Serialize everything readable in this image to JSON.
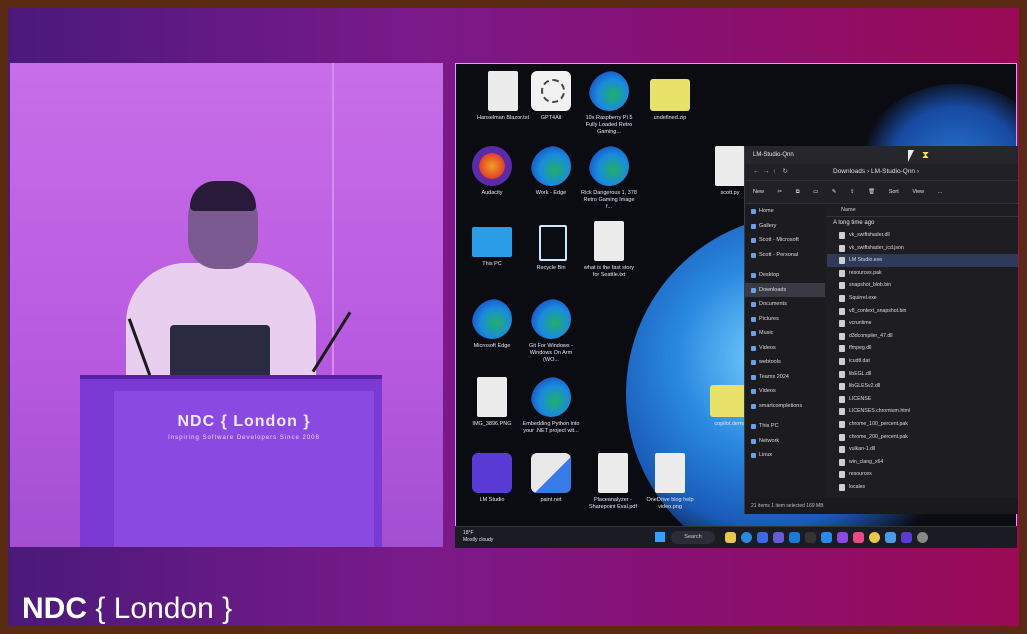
{
  "stage": {
    "podium_brand": "NDC { London }",
    "podium_tagline": "Inspiring Software Developers Since 2008",
    "footer_logo_bold": "NDC",
    "footer_logo_rest": "{ London }"
  },
  "desktop_icons": [
    {
      "label": "Hanselman Blazor.txt",
      "kind": "file"
    },
    {
      "label": "GPT4All",
      "kind": "pix"
    },
    {
      "label": "10x Raspberry Pi 5 Fully Loaded Retro Gaming...",
      "kind": "edge"
    },
    {
      "label": "undefined.zip",
      "kind": "folder"
    },
    {
      "label": "Audacity",
      "kind": "audacity"
    },
    {
      "label": "Work - Edge",
      "kind": "edge"
    },
    {
      "label": "Rick Dangerous 1, 378 Retro Gaming Image f...",
      "kind": "edge"
    },
    {
      "label": "This PC",
      "kind": "pc"
    },
    {
      "label": "Recycle Bin",
      "kind": "bin"
    },
    {
      "label": "what is the fast story for Seattle.txt",
      "kind": "file"
    },
    {
      "label": "Microsoft Edge",
      "kind": "edge"
    },
    {
      "label": "Git For Windows - Windows On Arm (WO...",
      "kind": "edge"
    },
    {
      "label": "IMG_3896.PNG",
      "kind": "file"
    },
    {
      "label": "Embedding Python into your .NET project wit...",
      "kind": "edge"
    },
    {
      "label": "LM Studio",
      "kind": "lm"
    },
    {
      "label": "paint.net",
      "kind": "paint"
    },
    {
      "label": "Placeanalyzer - Sharepoint Eval.pdf",
      "kind": "file"
    },
    {
      "label": "OneDrive blog help video.png",
      "kind": "file"
    },
    {
      "label": "copilot.demo",
      "kind": "folder"
    },
    {
      "label": "scott.py",
      "kind": "file"
    }
  ],
  "explorer": {
    "title": "LM-Studio-Qnn",
    "path": [
      "Downloads",
      "LM-Studio-Qnn"
    ],
    "toolbar": [
      "New",
      "Sort",
      "View",
      "..."
    ],
    "nav_labels": [
      "Home",
      "Gallery",
      "Scott - Microsoft",
      "Scott - Personal",
      "Desktop",
      "Downloads",
      "Documents",
      "Pictures",
      "Music",
      "Videos",
      "webtools",
      "Teams 2024",
      "Videos",
      "smartcompletions",
      "This PC",
      "Network",
      "Linux"
    ],
    "column_header": "Name",
    "group_label": "A long time ago",
    "files": [
      "vk_swiftshader.dll",
      "vk_swiftshader_icd.json",
      "LM Studio.exe",
      "resources.pak",
      "snapshot_blob.bin",
      "Squirrel.exe",
      "v8_context_snapshot.bin",
      "vcruntime",
      "d3dcompiler_47.dll",
      "ffmpeg.dll",
      "icudtl.dat",
      "libEGL.dll",
      "libGLESv2.dll",
      "LICENSE",
      "LICENSES.chromium.html",
      "chrome_100_percent.pak",
      "chrome_200_percent.pak",
      "vulkan-1.dll",
      "win_clang_x64",
      "resources",
      "locales"
    ],
    "selected_file": "LM Studio.exe",
    "status": "21 items    1 item selected  169 MB"
  },
  "taskbar": {
    "weather_temp": "18°F",
    "weather_desc": "Mostly cloudy",
    "search_label": "Search"
  }
}
